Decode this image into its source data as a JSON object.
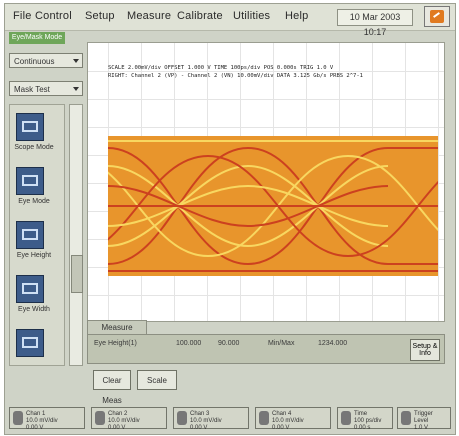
{
  "menu": {
    "items": [
      "File",
      "Control",
      "Setup",
      "Measure",
      "Calibrate",
      "Utilities",
      "Help"
    ],
    "datetime": "10 Mar 2003 10:17"
  },
  "left_panel": {
    "mode_tab": "Eye/Mask Mode",
    "acquisition_select": "Continuous",
    "measure_select": "Mask Test",
    "tools": [
      {
        "label": "Scope Mode",
        "icon": "scope-icon"
      },
      {
        "label": "Eye Mode",
        "icon": "eye-icon"
      },
      {
        "label": "Eye Height",
        "icon": "measure-icon"
      },
      {
        "label": "Eye Width",
        "icon": "measure-icon"
      },
      {
        "label": "",
        "icon": "measure-icon"
      }
    ]
  },
  "graph": {
    "info_line1": "SCALE 2.00mV/div  OFFSET 1.000 V  TIME 100ps/div  POS 0.000s  TRIG 1.0 V",
    "info_line2": "RIGHT: Channel 2 (VP) - Channel 2 (VN) 10.00mV/div  DATA 3.125 Gb/s  PRBS 2^7-1"
  },
  "measure": {
    "tab_label": "Measure",
    "row_label": "Eye Height(1)",
    "values": [
      "100.000",
      "90.000",
      "Min/Max",
      "1234.000"
    ],
    "setup_label": "Setup\n& Info"
  },
  "mid_buttons": {
    "clear_label": "Clear Meas",
    "scale_label": "Scale"
  },
  "channels": [
    {
      "label": "Chan 1\n10.0 mV/div\n0.00 V"
    },
    {
      "label": "Chan 2\n10.0 mV/div\n0.00 V"
    },
    {
      "label": "Chan 3\n10.0 mV/div\n0.00 V"
    },
    {
      "label": "Chan 4\n10.0 mV/div\n0.00 V"
    },
    {
      "label": "Time\n100 ps/div\n0.00 s"
    },
    {
      "label": "Trigger\nLevel\n1.0 V"
    }
  ],
  "colors": {
    "eye_base": "#e8952c",
    "eye_trace_red": "#c8331d",
    "eye_trace_yellow": "#fbe36a",
    "mode_tab": "#6fa65a",
    "help_icon": "#e07a20"
  }
}
